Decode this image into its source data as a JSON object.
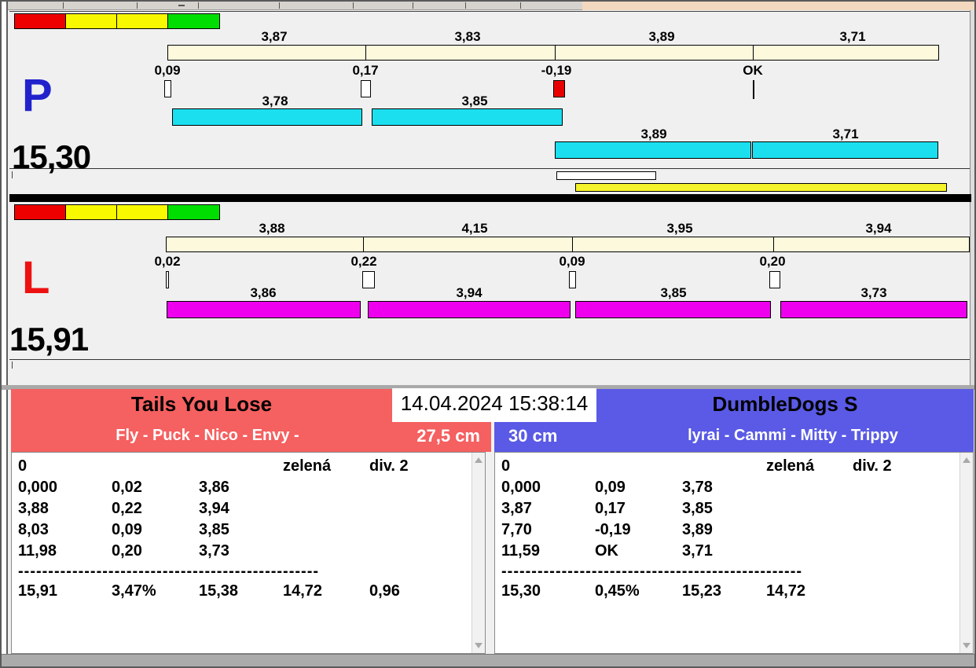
{
  "meter": {
    "scale_colors": [
      "#ee0000",
      "#f8f800",
      "#f8f800",
      "#00dd00"
    ],
    "split_bar_color": "#fcf9dd",
    "progress_bars": {
      "white": "#ffffff",
      "yellow": "#f5f32b"
    },
    "lanes": [
      {
        "id": "P",
        "letter": "P",
        "letter_color": "#2222cc",
        "total": "15,30",
        "bar_color": "#1bdfef",
        "splits": [
          "3,87",
          "3,83",
          "3,89",
          "3,71"
        ],
        "passes": [
          {
            "value": "0,09",
            "status": "normal",
            "box_color": "#ffffff"
          },
          {
            "value": "0,17",
            "status": "normal",
            "box_color": "#ffffff"
          },
          {
            "value": "-0,19",
            "status": "fault",
            "box_color": "#e80000"
          },
          {
            "value": "OK",
            "status": "ok"
          }
        ],
        "runs": [
          "3,78",
          "3,85",
          "3,89",
          "3,71"
        ]
      },
      {
        "id": "L",
        "letter": "L",
        "letter_color": "#ee1111",
        "total": "15,91",
        "bar_color": "#ee00ee",
        "splits": [
          "3,88",
          "4,15",
          "3,95",
          "3,94"
        ],
        "passes": [
          {
            "value": "0,02",
            "status": "normal",
            "box_color": "#ffffff"
          },
          {
            "value": "0,22",
            "status": "normal",
            "box_color": "#ffffff"
          },
          {
            "value": "0,09",
            "status": "normal",
            "box_color": "#ffffff"
          },
          {
            "value": "0,20",
            "status": "normal",
            "box_color": "#ffffff"
          }
        ],
        "runs": [
          "3,86",
          "3,94",
          "3,85",
          "3,73"
        ]
      }
    ]
  },
  "clock": {
    "datetime": "14.04.2024 15:38:14"
  },
  "teams": [
    {
      "name": "Tails You Lose",
      "members": "Fly - Puck - Nico - Envy -",
      "jump_height": "27,5 cm",
      "accent": "#f56060",
      "result": {
        "status_row": {
          "col1": "0",
          "col4": "zelená",
          "col5": "div. 2"
        },
        "legs": [
          [
            "0,000",
            "0,02",
            "3,86"
          ],
          [
            "3,88",
            "0,22",
            "3,94"
          ],
          [
            "8,03",
            "0,09",
            "3,85"
          ],
          [
            "11,98",
            "0,20",
            "3,73"
          ]
        ],
        "separator": "--------------------------------------------------",
        "totals": [
          "15,91",
          "3,47%",
          "15,38",
          "14,72",
          "0,96"
        ]
      }
    },
    {
      "name": "DumbleDogs S",
      "members": "lyrai - Cammi - Mitty - Trippy",
      "jump_height": "30 cm",
      "accent": "#5a5ae6",
      "result": {
        "status_row": {
          "col1": "0",
          "col4": "zelená",
          "col5": "div. 2"
        },
        "legs": [
          [
            "0,000",
            "0,09",
            "3,78"
          ],
          [
            "3,87",
            "0,17",
            "3,85"
          ],
          [
            "7,70",
            "-0,19",
            "3,89"
          ],
          [
            "11,59",
            "OK",
            "3,71"
          ]
        ],
        "separator": "--------------------------------------------------",
        "totals": [
          "15,30",
          "0,45%",
          "15,23",
          "14,72",
          ""
        ]
      }
    }
  ]
}
